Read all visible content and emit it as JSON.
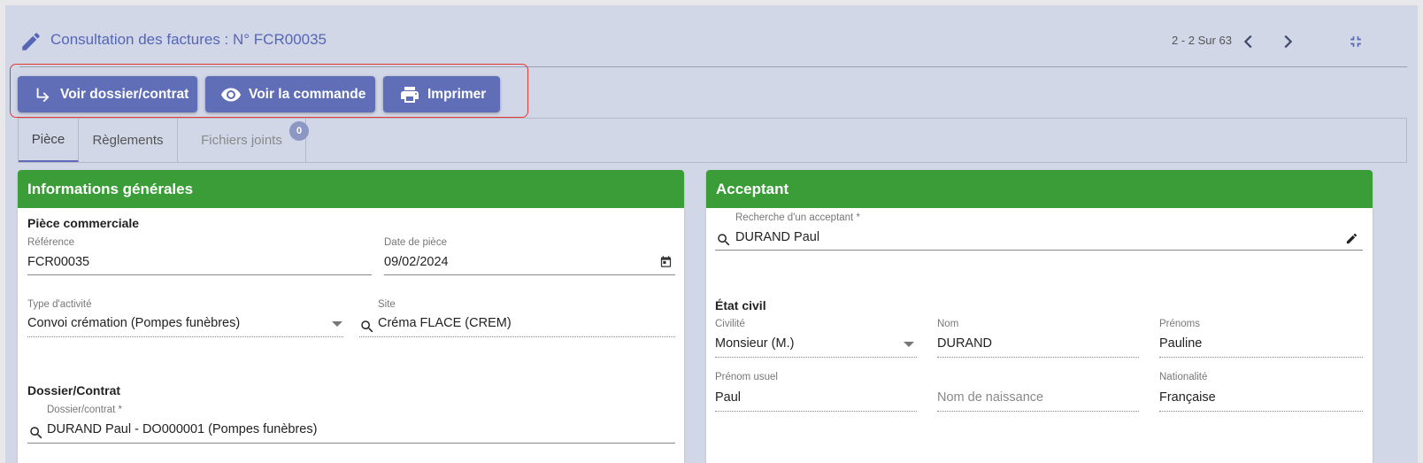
{
  "header": {
    "title": "Consultation des factures : N° FCR00035",
    "pager": "2 - 2 Sur 63"
  },
  "toolbar": {
    "view_contract": "Voir dossier/contrat",
    "view_order": "Voir la commande",
    "print": "Imprimer"
  },
  "tabs": [
    {
      "label": "Pièce"
    },
    {
      "label": "Règlements"
    },
    {
      "label": "Fichiers joints",
      "badge": "0"
    }
  ],
  "general": {
    "title": "Informations générales",
    "commercial_section": "Pièce commerciale",
    "reference": {
      "label": "Référence",
      "value": "FCR00035"
    },
    "date": {
      "label": "Date de pièce",
      "value": "09/02/2024"
    },
    "activity": {
      "label": "Type d'activité",
      "value": "Convoi crémation (Pompes funèbres)"
    },
    "site": {
      "label": "Site",
      "value": "Créma FLACE (CREM)"
    },
    "dossier_section": "Dossier/Contrat",
    "dossier": {
      "label": "Dossier/contrat *",
      "value": "DURAND Paul - DO000001 (Pompes funèbres)"
    }
  },
  "acceptant": {
    "title": "Acceptant",
    "search": {
      "label": "Recherche d'un acceptant *",
      "value": "DURAND Paul"
    },
    "civil_section": "État civil",
    "civilite": {
      "label": "Civilité",
      "value": "Monsieur (M.)"
    },
    "nom": {
      "label": "Nom",
      "value": "DURAND"
    },
    "prenoms": {
      "label": "Prénoms",
      "value": "Pauline"
    },
    "prenom_usuel": {
      "label": "Prénom usuel",
      "value": "Paul"
    },
    "nom_naissance": {
      "placeholder": "Nom de naissance"
    },
    "nationalite": {
      "label": "Nationalité",
      "value": "Française"
    }
  },
  "colors": {
    "accent": "#5f6eb7",
    "card_header": "#3a9d37",
    "page_background": "#d1d7e7",
    "highlight_border": "#e53935"
  }
}
